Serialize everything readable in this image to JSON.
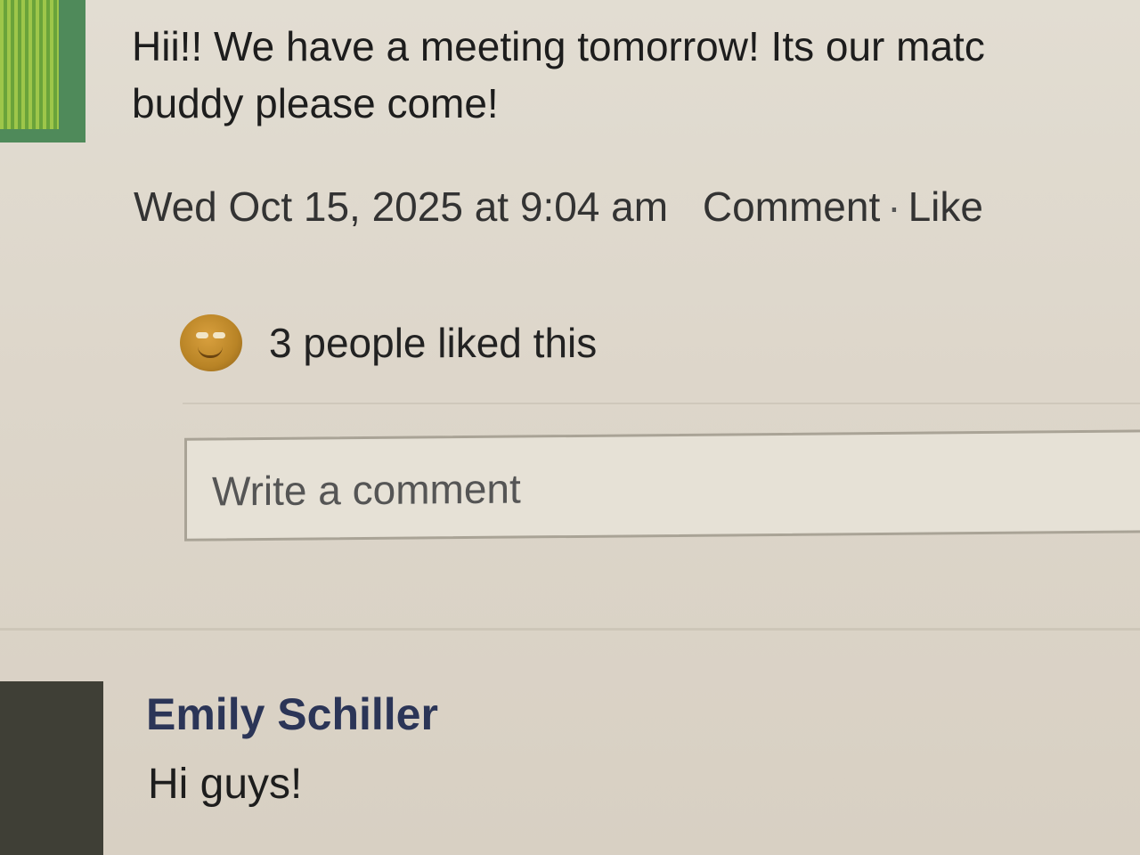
{
  "post": {
    "text": "Hii!! We have a meeting tomorrow! Its our match buddy please come!",
    "line1": "Hii!! We have a meeting tomorrow! Its our matc",
    "line2": "buddy please come!",
    "timestamp": "Wed Oct 15, 2025 at 9:04 am",
    "actions": {
      "comment": "Comment",
      "separator": "·",
      "like": "Like"
    },
    "likes": {
      "icon": "smiley-emoji-icon",
      "text": "3 people liked this"
    },
    "comment_input": {
      "placeholder": "Write a comment",
      "value": ""
    }
  },
  "reply": {
    "author": "Emily Schiller",
    "text": "Hi guys!"
  },
  "colors": {
    "background": "#ddd6ca",
    "author_name": "#2b3557",
    "avatar_top": "#4f8a5a",
    "avatar_reply": "#3f3f36"
  }
}
